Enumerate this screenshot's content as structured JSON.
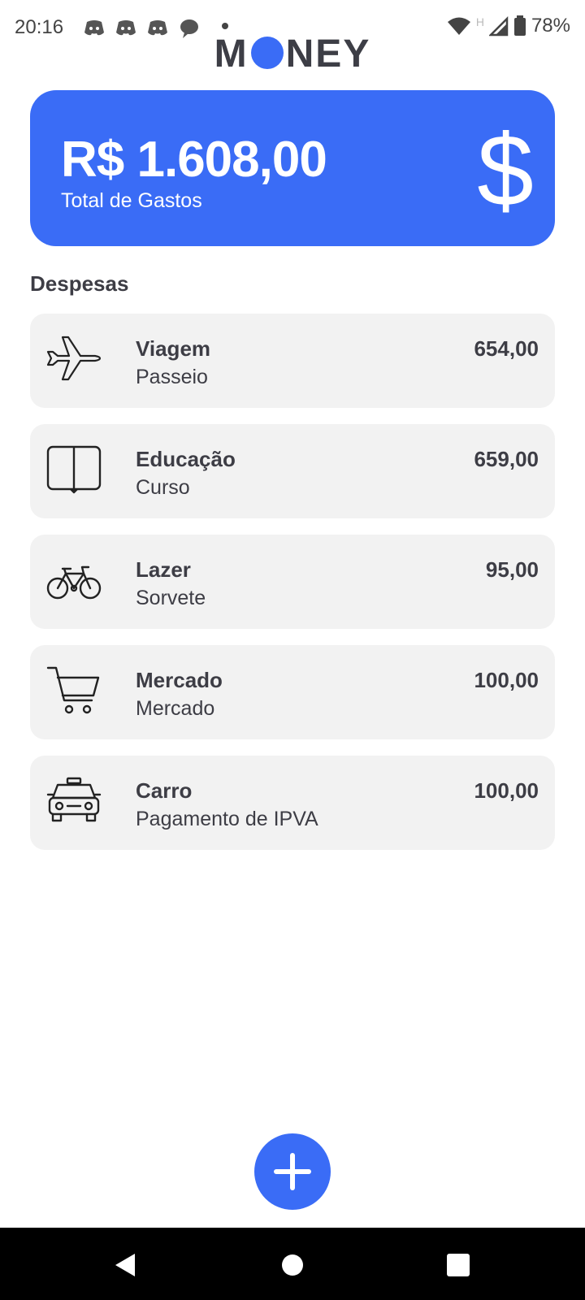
{
  "status_bar": {
    "time": "20:16",
    "battery": "78%",
    "network_label": "H",
    "icons": [
      "discord-icon",
      "discord-icon",
      "discord-icon",
      "chat-bubble-icon",
      "wifi-icon",
      "signal-icon",
      "battery-icon"
    ]
  },
  "app": {
    "logo_left": "M",
    "logo_right": "NEY",
    "accent_color": "#3a6cf6"
  },
  "summary": {
    "total": "R$ 1.608,00",
    "label": "Total de Gastos",
    "icon": "dollar-icon"
  },
  "section_title": "Despesas",
  "expenses": [
    {
      "category": "Viagem",
      "description": "Passeio",
      "value": "654,00",
      "icon": "airplane-icon"
    },
    {
      "category": "Educação",
      "description": "Curso",
      "value": "659,00",
      "icon": "book-icon"
    },
    {
      "category": "Lazer",
      "description": "Sorvete",
      "value": "95,00",
      "icon": "bicycle-icon"
    },
    {
      "category": "Mercado",
      "description": "Mercado",
      "value": "100,00",
      "icon": "cart-icon"
    },
    {
      "category": "Carro",
      "description": "Pagamento de IPVA",
      "value": "100,00",
      "icon": "taxi-icon"
    }
  ],
  "fab_icon": "plus-icon",
  "navigation": [
    "back-icon",
    "home-icon",
    "recents-icon"
  ]
}
